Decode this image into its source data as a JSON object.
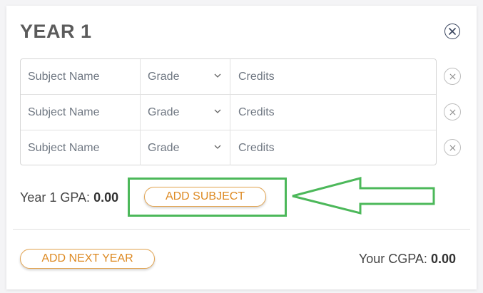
{
  "year": {
    "title": "YEAR 1",
    "rows": [
      {
        "subject_placeholder": "Subject  Name",
        "grade": "Grade",
        "credits_placeholder": "Credits"
      },
      {
        "subject_placeholder": "Subject  Name",
        "grade": "Grade",
        "credits_placeholder": "Credits"
      },
      {
        "subject_placeholder": "Subject  Name",
        "grade": "Grade",
        "credits_placeholder": "Credits"
      }
    ],
    "gpa_label": "Year 1 GPA:",
    "gpa_value": "0.00",
    "add_subject_label": "ADD SUBJECT"
  },
  "footer": {
    "add_year_label": "ADD NEXT YEAR",
    "cgpa_label": "Your CGPA:",
    "cgpa_value": "0.00"
  },
  "icons": {
    "close": "close-icon",
    "remove_row": "close-icon",
    "dropdown": "chevron-down-icon",
    "annotation": "arrow-left-icon"
  },
  "colors": {
    "accent": "#dd8a23",
    "highlight": "#4cb85a",
    "title": "#5b5b5b"
  }
}
